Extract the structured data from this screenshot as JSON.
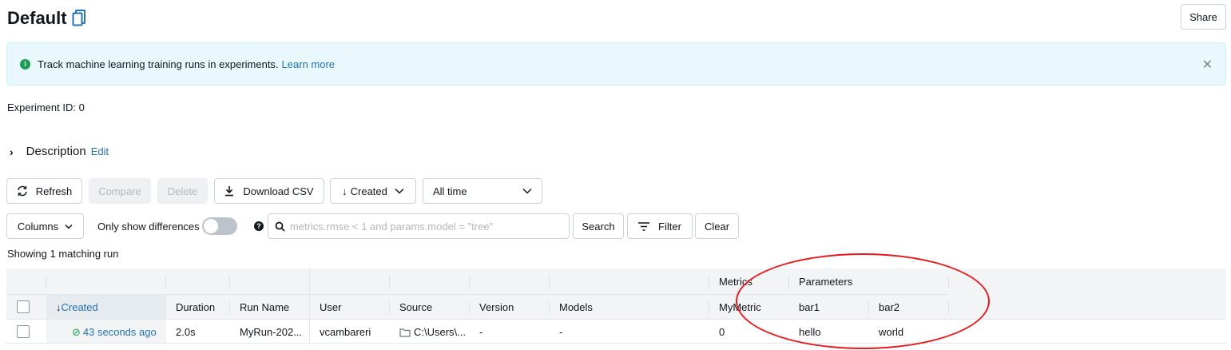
{
  "header": {
    "title": "Default",
    "share_label": "Share"
  },
  "banner": {
    "message": "Track machine learning training runs in experiments.",
    "link": "Learn more"
  },
  "experiment_id_label": "Experiment ID:",
  "experiment_id": "0",
  "description": {
    "label": "Description",
    "edit": "Edit"
  },
  "toolbar": {
    "refresh": "Refresh",
    "compare": "Compare",
    "delete": "Delete",
    "download_csv": "Download CSV",
    "sort": "Created",
    "time_range": "All time"
  },
  "filters": {
    "columns": "Columns",
    "only_show_differences": "Only show differences",
    "search_placeholder": "metrics.rmse < 1 and params.model = \"tree\"",
    "search": "Search",
    "filter": "Filter",
    "clear": "Clear"
  },
  "showing": "Showing 1 matching run",
  "table": {
    "groups": {
      "metrics": "Metrics",
      "parameters": "Parameters"
    },
    "columns": {
      "created": "Created",
      "duration": "Duration",
      "run_name": "Run Name",
      "user": "User",
      "source": "Source",
      "version": "Version",
      "models": "Models",
      "metric": "MyMetric",
      "bar1": "bar1",
      "bar2": "bar2"
    },
    "rows": [
      {
        "created": "43 seconds ago",
        "duration": "2.0s",
        "run_name": "MyRun-202...",
        "user": "vcambareri",
        "source": "C:\\Users\\...",
        "version": "-",
        "models": "-",
        "metric": "0",
        "bar1": "hello",
        "bar2": "world"
      }
    ]
  },
  "colors": {
    "accent": "#2272b4",
    "success": "#1a9e54",
    "annotation": "#e8191c"
  }
}
